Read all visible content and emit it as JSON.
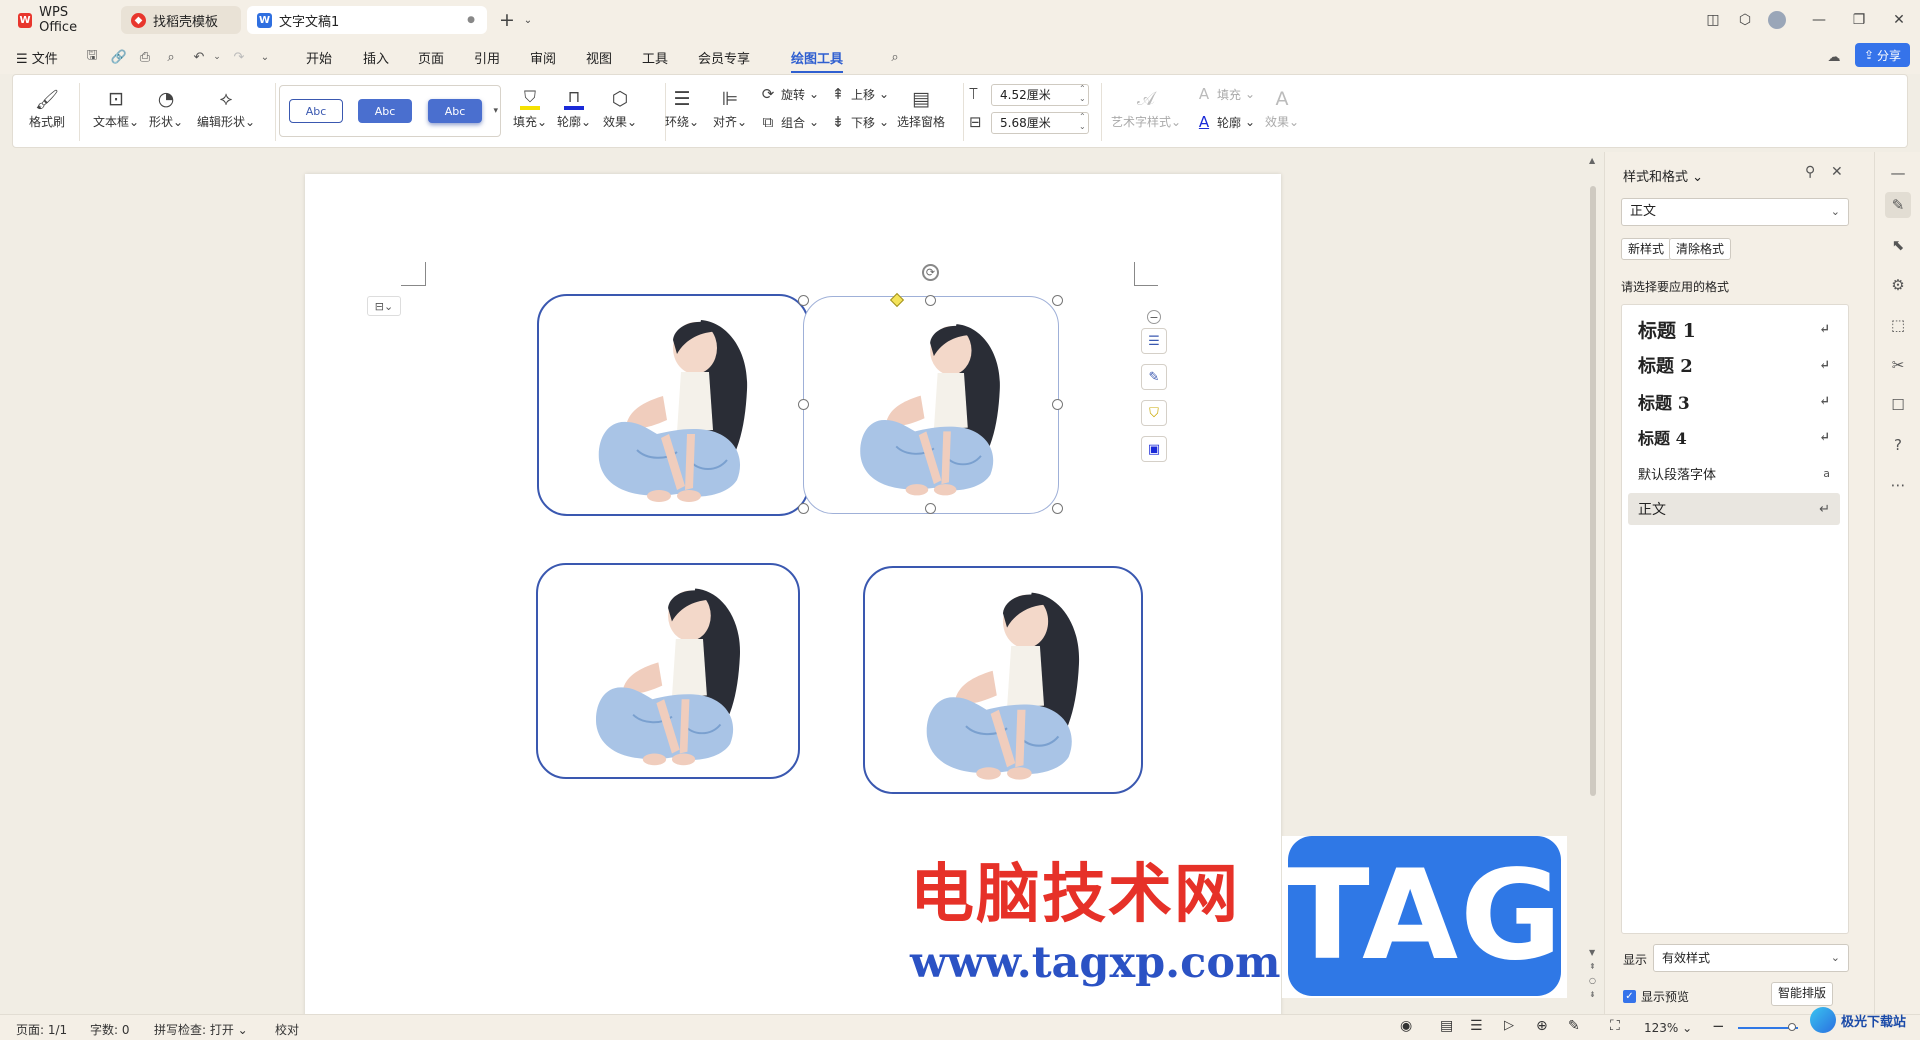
{
  "tabs": [
    {
      "label": "WPS Office",
      "icon": "wps-logo-icon"
    },
    {
      "label": "找稻壳模板",
      "icon": "docer-icon"
    },
    {
      "label": "文字文稿1",
      "icon": "writer-doc-icon"
    }
  ],
  "new_tab_symbol": "+",
  "menu": {
    "file": "文件",
    "items": [
      "开始",
      "插入",
      "页面",
      "引用",
      "审阅",
      "视图",
      "工具",
      "会员专享",
      "绘图工具"
    ],
    "active": "绘图工具",
    "share": "分享"
  },
  "ribbon": {
    "format_painter": "格式刷",
    "textbox": "文本框",
    "shape": "形状",
    "edit_shape": "编辑形状",
    "style_samples": [
      "Abc",
      "Abc",
      "Abc"
    ],
    "fill": "填充",
    "outline": "轮廓",
    "effect": "效果",
    "wrap": "环绕",
    "align": "对齐",
    "rotate": "旋转",
    "group": "组合",
    "bring_forward": "上移",
    "send_backward": "下移",
    "selection_pane": "选择窗格",
    "height": "4.52厘米",
    "width": "5.68厘米",
    "art_style": "艺术字样式",
    "text_fill": "填充",
    "text_outline": "轮廓",
    "text_effect": "效果",
    "colors": {
      "fill_bar": "#f5e100",
      "outline_bar": "#1a2ad8",
      "accent": "#3573ea"
    }
  },
  "watermark": {
    "site_name": "电脑技术网",
    "url": "www.tagxp.com",
    "tag": "TAG"
  },
  "panel": {
    "title": "样式和格式",
    "current_style": "正文",
    "new_style": "新样式",
    "clear_format": "清除格式",
    "prompt": "请选择要应用的格式",
    "styles": [
      {
        "label": "标题 1",
        "mark": "↵"
      },
      {
        "label": "标题 2",
        "mark": "↵"
      },
      {
        "label": "标题 3",
        "mark": "↵"
      },
      {
        "label": "标题 4",
        "mark": "↵"
      },
      {
        "label": "默认段落字体",
        "mark": "a"
      },
      {
        "label": "正文",
        "mark": "↵"
      }
    ],
    "show_label": "显示",
    "show_value": "有效样式",
    "preview_label": "显示预览",
    "preview_checked": true,
    "smart_layout": "智能排版"
  },
  "status": {
    "page": "页面: 1/1",
    "words": "字数: 0",
    "spellcheck": "拼写检查: 打开",
    "proofread": "校对",
    "zoom": "123%"
  },
  "corner_watermark": "极光下载站"
}
